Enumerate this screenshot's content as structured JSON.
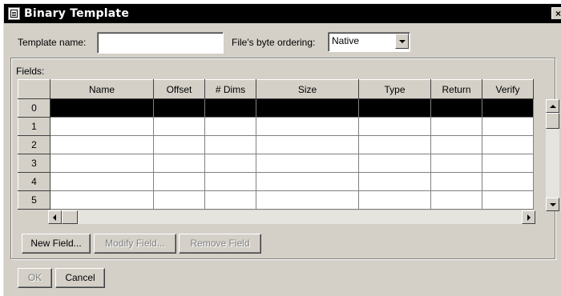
{
  "window": {
    "title": "Binary Template",
    "close_glyph": "×"
  },
  "form": {
    "template_name_label": "Template name:",
    "template_name_value": "",
    "byte_ordering_label": "File's byte ordering:",
    "byte_ordering_value": "Native"
  },
  "fields": {
    "group_label": "Fields:",
    "columns": [
      "Name",
      "Offset",
      "# Dims",
      "Size",
      "Type",
      "Return",
      "Verify"
    ],
    "rows": [
      "0",
      "1",
      "2",
      "3",
      "4",
      "5"
    ],
    "selected_row": 0
  },
  "field_buttons": {
    "new": "New Field...",
    "modify": "Modify Field...",
    "remove": "Remove Field"
  },
  "dialog_buttons": {
    "ok": "OK",
    "cancel": "Cancel"
  }
}
